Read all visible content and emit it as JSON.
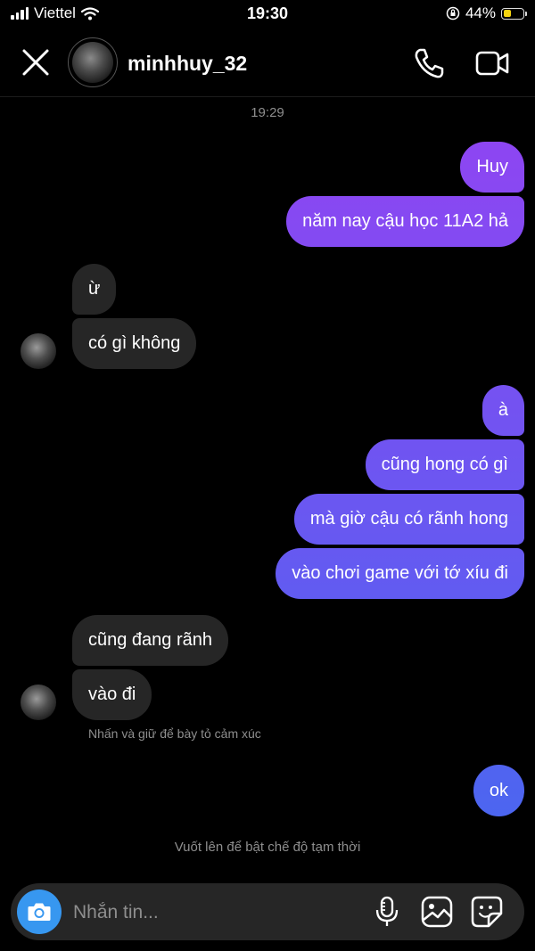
{
  "status_bar": {
    "carrier": "Viettel",
    "time": "19:30",
    "battery_text": "44%",
    "battery_level": 0.44
  },
  "header": {
    "username": "minhhuy_32"
  },
  "timestamp": "19:29",
  "messages": {
    "m1": "Huy",
    "m2": "năm nay cậu học 11A2 hả",
    "m3": "ừ",
    "m4": "có gì không",
    "m5": "à",
    "m6": "cũng hong có gì",
    "m7": "mà giờ cậu có rãnh hong",
    "m8": "vào chơi game với tớ xíu đi",
    "m9": "cũng đang rãnh",
    "m10": "vào đi",
    "m11": "ok"
  },
  "reaction_hint": "Nhấn và giữ để bày tỏ cảm xúc",
  "swipe_hint": "Vuốt lên để bật chế độ tạm thời",
  "composer": {
    "placeholder": "Nhắn tin..."
  },
  "colors": {
    "sent_gradient_top": "#9b3ff2",
    "sent_gradient_bottom": "#3f6cf0",
    "received_bubble": "#262626",
    "camera_button": "#3797f0",
    "battery_fill": "#f5d40f"
  },
  "icons": [
    "close-icon",
    "phone-icon",
    "video-call-icon",
    "camera-icon",
    "microphone-icon",
    "gallery-icon",
    "sticker-icon"
  ]
}
